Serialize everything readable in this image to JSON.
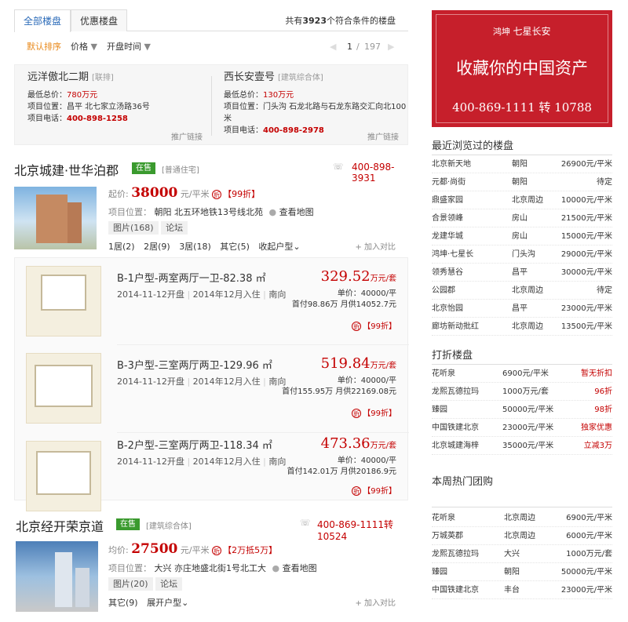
{
  "tabs": {
    "all": "全部楼盘",
    "discount": "优惠楼盘"
  },
  "result": {
    "prefix": "共有",
    "count": "3923",
    "suffix": "个符合条件的楼盘"
  },
  "sort": {
    "default": "默认排序",
    "price": "价格",
    "open_time": "开盘时间",
    "page_current": "1",
    "page_sep": "/",
    "page_total": "197"
  },
  "promos": [
    {
      "name": "远洋傲北二期",
      "tag": "[联排]",
      "price_label": "最低总价：",
      "price": "780万元",
      "loc": "项目位置：昌平 北七家立汤路36号",
      "phone_label": "项目电话：",
      "phone": "400-898-1258",
      "link": "推广链接"
    },
    {
      "name": "西长安壹号",
      "tag": "[建筑综合体]",
      "price_label": "最低总价：",
      "price": "130万元",
      "loc": "项目位置：门头沟 石龙北路与石龙东路交汇向北100米",
      "phone_label": "项目电话：",
      "phone": "400-898-2978",
      "link": "推广链接"
    }
  ],
  "project1": {
    "title": "北京城建·世华泊郡",
    "status": "在售",
    "type": "[普通住宅]",
    "phone": "400-898-3931",
    "price_label": "起价:",
    "price": "38000",
    "price_unit": "元/平米",
    "discount": "【99折】",
    "loc_label": "项目位置：",
    "loc": "朝阳 北五环地铁13号线北苑",
    "map": "查看地图",
    "pics": "图片(168)",
    "forum": "论坛",
    "rooms": [
      "1居(2)",
      "2居(9)",
      "3居(18)",
      "其它(5)",
      "收起户型"
    ],
    "compare": "加入对比",
    "units": [
      {
        "name": "B-1户型-两室两厅一卫-82.38 ㎡",
        "open": "2014-11-12开盘",
        "checkin": "2014年12月入住",
        "facing": "南向",
        "total": "329.52",
        "total_unit": "万元/套",
        "unit_price": "单价：40000/平",
        "pay": "首付98.86万 月供14052.7元",
        "disc": "【99折】"
      },
      {
        "name": "B-3户型-三室两厅两卫-129.96 ㎡",
        "open": "2014-11-12开盘",
        "checkin": "2014年12月入住",
        "facing": "南向",
        "total": "519.84",
        "total_unit": "万元/套",
        "unit_price": "单价：40000/平",
        "pay": "首付155.95万 月供22169.08元",
        "disc": "【99折】"
      },
      {
        "name": "B-2户型-三室两厅两卫-118.34 ㎡",
        "open": "2014-11-12开盘",
        "checkin": "2014年12月入住",
        "facing": "南向",
        "total": "473.36",
        "total_unit": "万元/套",
        "unit_price": "单价：40000/平",
        "pay": "首付142.01万 月供20186.9元",
        "disc": "【99折】"
      }
    ]
  },
  "project2": {
    "title": "北京经开荣京道",
    "status": "在售",
    "type": "[建筑综合体]",
    "phone": "400-869-1111转 10524",
    "price_label": "均价:",
    "price": "27500",
    "price_unit": "元/平米",
    "discount": "【2万抵5万】",
    "loc_label": "项目位置：",
    "loc": "大兴 亦庄地盛北街1号北工大",
    "map": "查看地图",
    "pics": "图片(20)",
    "forum": "论坛",
    "other": "其它(9)",
    "expand": "展开户型",
    "compare": "加入对比"
  },
  "ad": {
    "brand": "鸿坤",
    "brand2": "七星长安",
    "slogan": "收藏你的中国资产",
    "phone": "400-869-1111 转 10788"
  },
  "recent": {
    "title": "最近浏览过的楼盘",
    "rows": [
      [
        "北京新天地",
        "朝阳",
        "26900元/平米"
      ],
      [
        "元都·尚街",
        "朝阳",
        "待定"
      ],
      [
        "鼎盛家园",
        "北京周边",
        "10000元/平米"
      ],
      [
        "合景领峰",
        "房山",
        "21500元/平米"
      ],
      [
        "龙建华城",
        "房山",
        "15000元/平米"
      ],
      [
        "鸿坤·七星长",
        "门头沟",
        "29000元/平米"
      ],
      [
        "领秀慧谷",
        "昌平",
        "30000元/平米"
      ],
      [
        "公园郡",
        "北京周边",
        "待定"
      ],
      [
        "北京怡园",
        "昌平",
        "23000元/平米"
      ],
      [
        "廊坊新动批红",
        "北京周边",
        "13500元/平米"
      ]
    ]
  },
  "discount": {
    "title": "打折楼盘",
    "rows": [
      [
        "花听泉",
        "6900元/平米",
        "暂无折扣"
      ],
      [
        "龙熙瓦德拉玛",
        "1000万元/套",
        "96折"
      ],
      [
        "臻园",
        "50000元/平米",
        "98折"
      ],
      [
        "中国铁建北京",
        "23000元/平米",
        "独家优惠"
      ],
      [
        "北京城建海梓",
        "35000元/平米",
        "立减3万"
      ]
    ]
  },
  "group": {
    "title": "本周热门团购",
    "rows": [
      [
        "花听泉",
        "北京周边",
        "6900元/平米"
      ],
      [
        "万城英郡",
        "北京周边",
        "6000元/平米"
      ],
      [
        "龙熙瓦德拉玛",
        "大兴",
        "1000万元/套"
      ],
      [
        "臻园",
        "朝阳",
        "50000元/平米"
      ],
      [
        "中国铁建北京",
        "丰台",
        "23000元/平米"
      ]
    ]
  }
}
